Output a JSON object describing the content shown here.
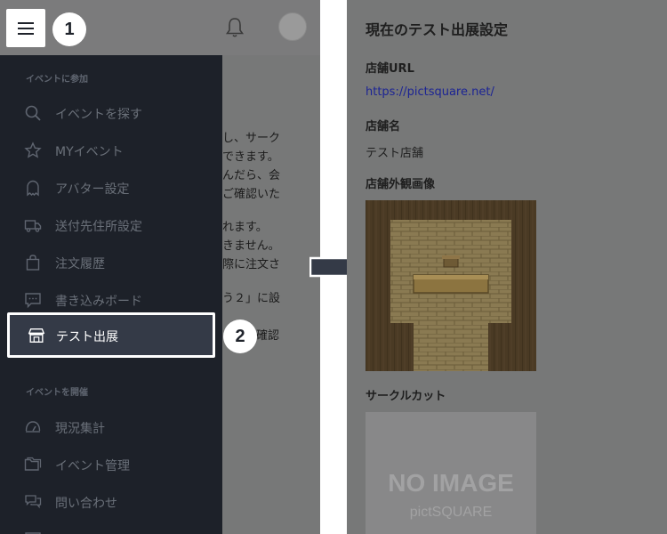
{
  "left": {
    "step1": "1",
    "step2": "2",
    "background_text": [
      "し、サーク",
      "できます。",
      "んだら、会",
      "ご確認いた",
      "れます。",
      "きません。",
      "際に注文さ",
      "う２」に設",
      "確認"
    ],
    "drawer": {
      "section_join": "イベントに参加",
      "section_host": "イベントを開催",
      "items_join": [
        {
          "label": "イベントを探す",
          "icon": "search-icon"
        },
        {
          "label": "MYイベント",
          "icon": "star-icon"
        },
        {
          "label": "アバター設定",
          "icon": "ghost-icon"
        },
        {
          "label": "送付先住所設定",
          "icon": "truck-icon"
        },
        {
          "label": "注文履歴",
          "icon": "bag-icon"
        },
        {
          "label": "書き込みボード",
          "icon": "chat-icon"
        }
      ],
      "active_item": {
        "label": "テスト出展",
        "icon": "shop-icon"
      },
      "items_host": [
        {
          "label": "現況集計",
          "icon": "gauge-icon"
        },
        {
          "label": "イベント管理",
          "icon": "folder-icon"
        },
        {
          "label": "問い合わせ",
          "icon": "inquiry-icon"
        }
      ]
    }
  },
  "right": {
    "title": "現在のテスト出展設定",
    "url_label": "店舗URL",
    "url_value": "https://pictsquare.net/",
    "name_label": "店舗名",
    "name_value": "テスト店舗",
    "exterior_label": "店舗外観画像",
    "circle_cut_label": "サークルカット",
    "placeholder_line1": "NO IMAGE",
    "placeholder_line2": "pictSQUARE"
  },
  "colors": {
    "drawer_bg": "#1d2129",
    "active_bg": "#343a47",
    "overlay": "#777878",
    "link": "#1c2494"
  }
}
